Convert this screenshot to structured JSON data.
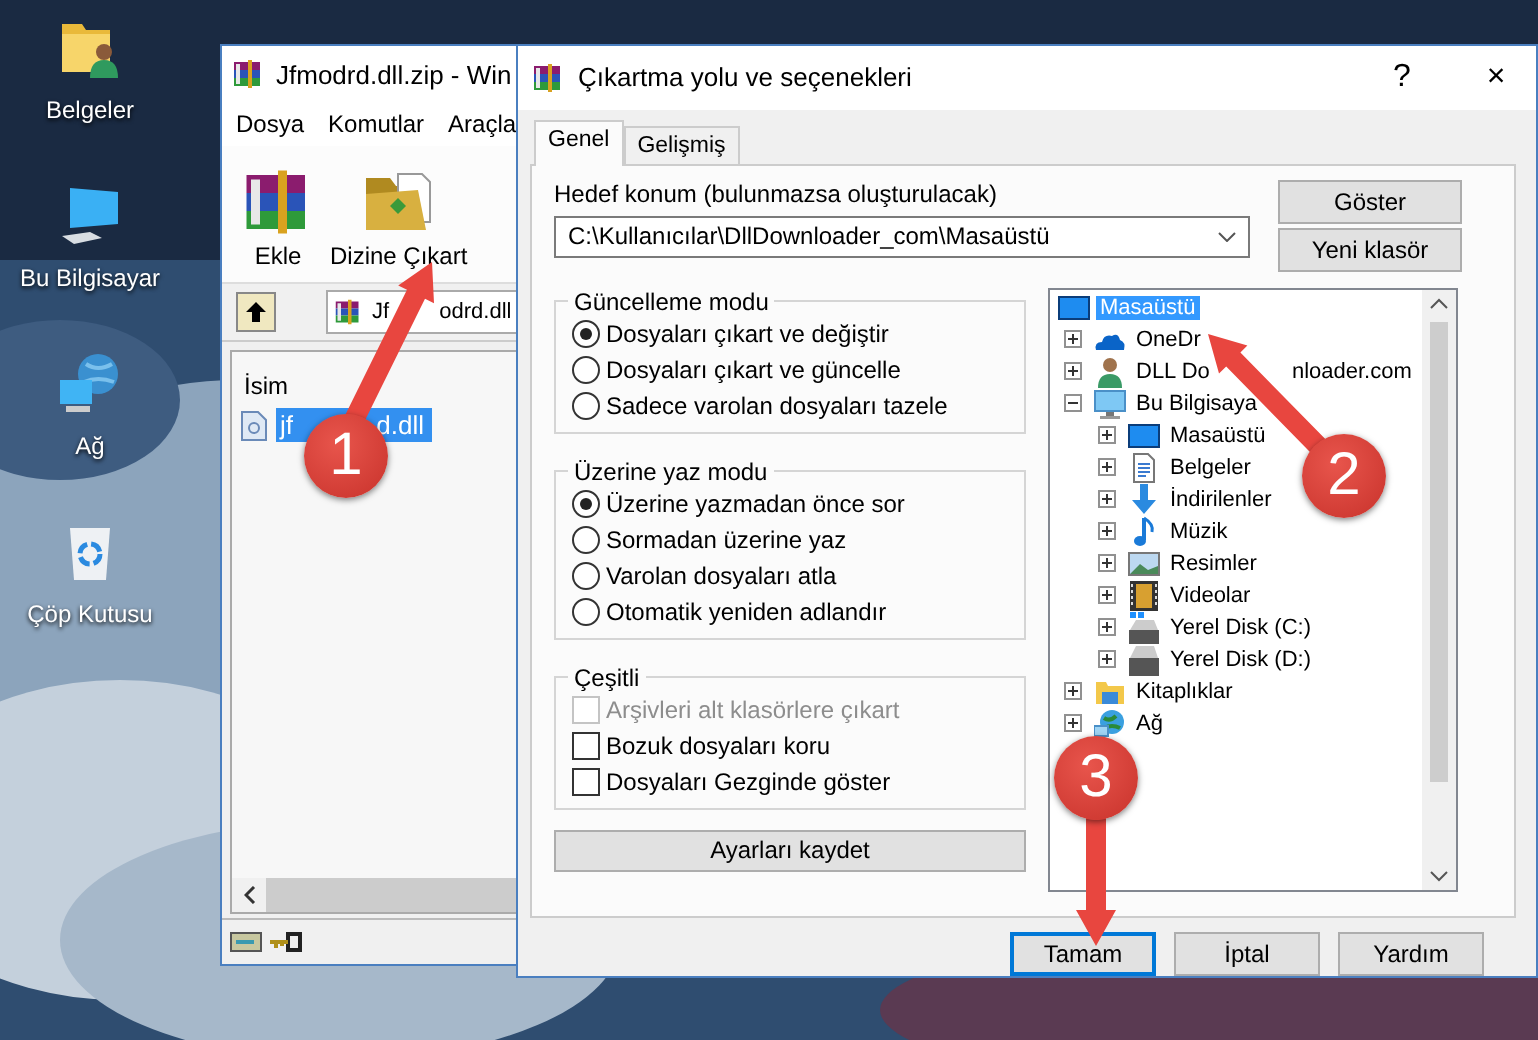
{
  "desktop_icons": [
    {
      "label": "Belgeler",
      "kind": "user-folder"
    },
    {
      "label": "Bu Bilgisayar",
      "kind": "computer"
    },
    {
      "label": "Ağ",
      "kind": "network"
    },
    {
      "label": "Çöp Kutusu",
      "kind": "recycle-bin"
    }
  ],
  "archive_window": {
    "title": "Jfmodrd.dll.zip - Win",
    "menu": [
      "Dosya",
      "Komutlar",
      "Araçla"
    ],
    "toolbar": [
      {
        "label": "Ekle",
        "kind": "add"
      },
      {
        "label": "Dizine Çıkart",
        "kind": "extract"
      }
    ],
    "address_parts": [
      "Jf",
      "odrd.dll"
    ],
    "columns": [
      "İsim"
    ],
    "files": [
      {
        "name_parts": [
          "jf",
          "d.dll"
        ],
        "selected": true
      }
    ]
  },
  "dialog": {
    "title": "Çıkartma yolu ve seçenekleri",
    "title_buttons": [
      "?",
      "×"
    ],
    "tabs": [
      {
        "label": "Genel",
        "selected": true
      },
      {
        "label": "Gelişmiş",
        "selected": false
      }
    ],
    "destination": {
      "label": "Hedef konum (bulunmazsa oluşturulacak)",
      "value": "C:\\Kullanıcılar\\DllDownloader_com\\Masaüstü"
    },
    "side_buttons": [
      "Göster",
      "Yeni klasör"
    ],
    "groups": [
      {
        "title": "Güncelleme modu",
        "kind": "radio",
        "options": [
          {
            "label": "Dosyaları çıkart ve değiştir",
            "selected": true
          },
          {
            "label": "Dosyaları çıkart ve güncelle",
            "selected": false
          },
          {
            "label": "Sadece varolan dosyaları tazele",
            "selected": false
          }
        ]
      },
      {
        "title": "Üzerine yaz modu",
        "kind": "radio",
        "options": [
          {
            "label": "Üzerine yazmadan önce sor",
            "selected": true
          },
          {
            "label": "Sormadan üzerine yaz",
            "selected": false
          },
          {
            "label": "Varolan dosyaları atla",
            "selected": false
          },
          {
            "label": "Otomatik yeniden adlandır",
            "selected": false
          }
        ]
      },
      {
        "title": "Çeşitli",
        "kind": "checkbox",
        "options": [
          {
            "label": "Arşivleri alt klasörlere çıkart",
            "checked": false,
            "disabled": true
          },
          {
            "label": "Bozuk dosyaları koru",
            "checked": false,
            "disabled": false
          },
          {
            "label": "Dosyaları Gezginde göster",
            "checked": false,
            "disabled": false
          }
        ]
      }
    ],
    "save_button": "Ayarları kaydet",
    "tree": [
      {
        "label": "Masaüstü",
        "kind": "desktop",
        "selected": true,
        "children": [
          {
            "label": "OneDr",
            "kind": "onedrive",
            "expanded": false,
            "selected": false
          },
          {
            "label_parts": [
              "DLL Do",
              "nloader.com"
            ],
            "kind": "user",
            "expanded": false,
            "selected": false
          },
          {
            "label": "Bu Bilgisaya",
            "kind": "computer",
            "expanded": true,
            "selected": false,
            "children": [
              {
                "label": "Masaüstü",
                "kind": "desktop",
                "expanded": false,
                "selected": false
              },
              {
                "label": "Belgeler",
                "kind": "documents",
                "expanded": false,
                "selected": false
              },
              {
                "label": "İndirilenler",
                "kind": "download",
                "expanded": false,
                "selected": false
              },
              {
                "label": "Müzik",
                "kind": "music",
                "expanded": false,
                "selected": false
              },
              {
                "label": "Resimler",
                "kind": "pictures",
                "expanded": false,
                "selected": false
              },
              {
                "label": "Videolar",
                "kind": "videos",
                "expanded": false,
                "selected": false
              },
              {
                "label": "Yerel Disk (C:)",
                "kind": "system-drive",
                "expanded": false,
                "selected": false
              },
              {
                "label": "Yerel Disk (D:)",
                "kind": "drive",
                "expanded": false,
                "selected": false
              }
            ]
          },
          {
            "label": "Kitaplıklar",
            "kind": "libraries",
            "expanded": false,
            "selected": false
          },
          {
            "label": "Ağ",
            "kind": "network",
            "expanded": false,
            "selected": false
          }
        ]
      }
    ],
    "footer_buttons": [
      {
        "label": "Tamam",
        "default": true
      },
      {
        "label": "İptal",
        "default": false
      },
      {
        "label": "Yardım",
        "default": false
      }
    ]
  },
  "annotations": [
    {
      "number": "1"
    },
    {
      "number": "2"
    },
    {
      "number": "3"
    }
  ]
}
